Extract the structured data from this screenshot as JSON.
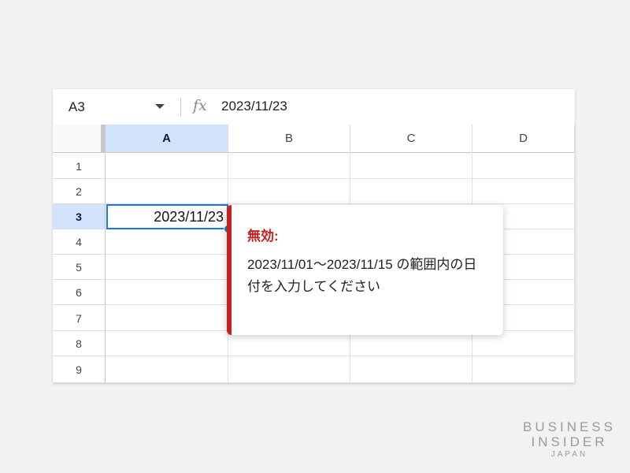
{
  "formula_bar": {
    "name_box": "A3",
    "fx_label": "fx",
    "formula_value": "2023/11/23"
  },
  "columns": [
    "A",
    "B",
    "C",
    "D"
  ],
  "rows": [
    "1",
    "2",
    "3",
    "4",
    "5",
    "6",
    "7",
    "8",
    "9"
  ],
  "active_cell": {
    "value": "2023/11/23"
  },
  "validation_popup": {
    "title": "無効:",
    "message": "2023/11/01〜2023/11/15 の範囲内の日付を入力してください"
  },
  "watermark": {
    "line1": "BUSINESS",
    "line2": "INSIDER",
    "line3": "JAPAN"
  },
  "colors": {
    "selection": "#1a73e8",
    "header_highlight": "#d3e3fd",
    "error": "#c5221f"
  }
}
